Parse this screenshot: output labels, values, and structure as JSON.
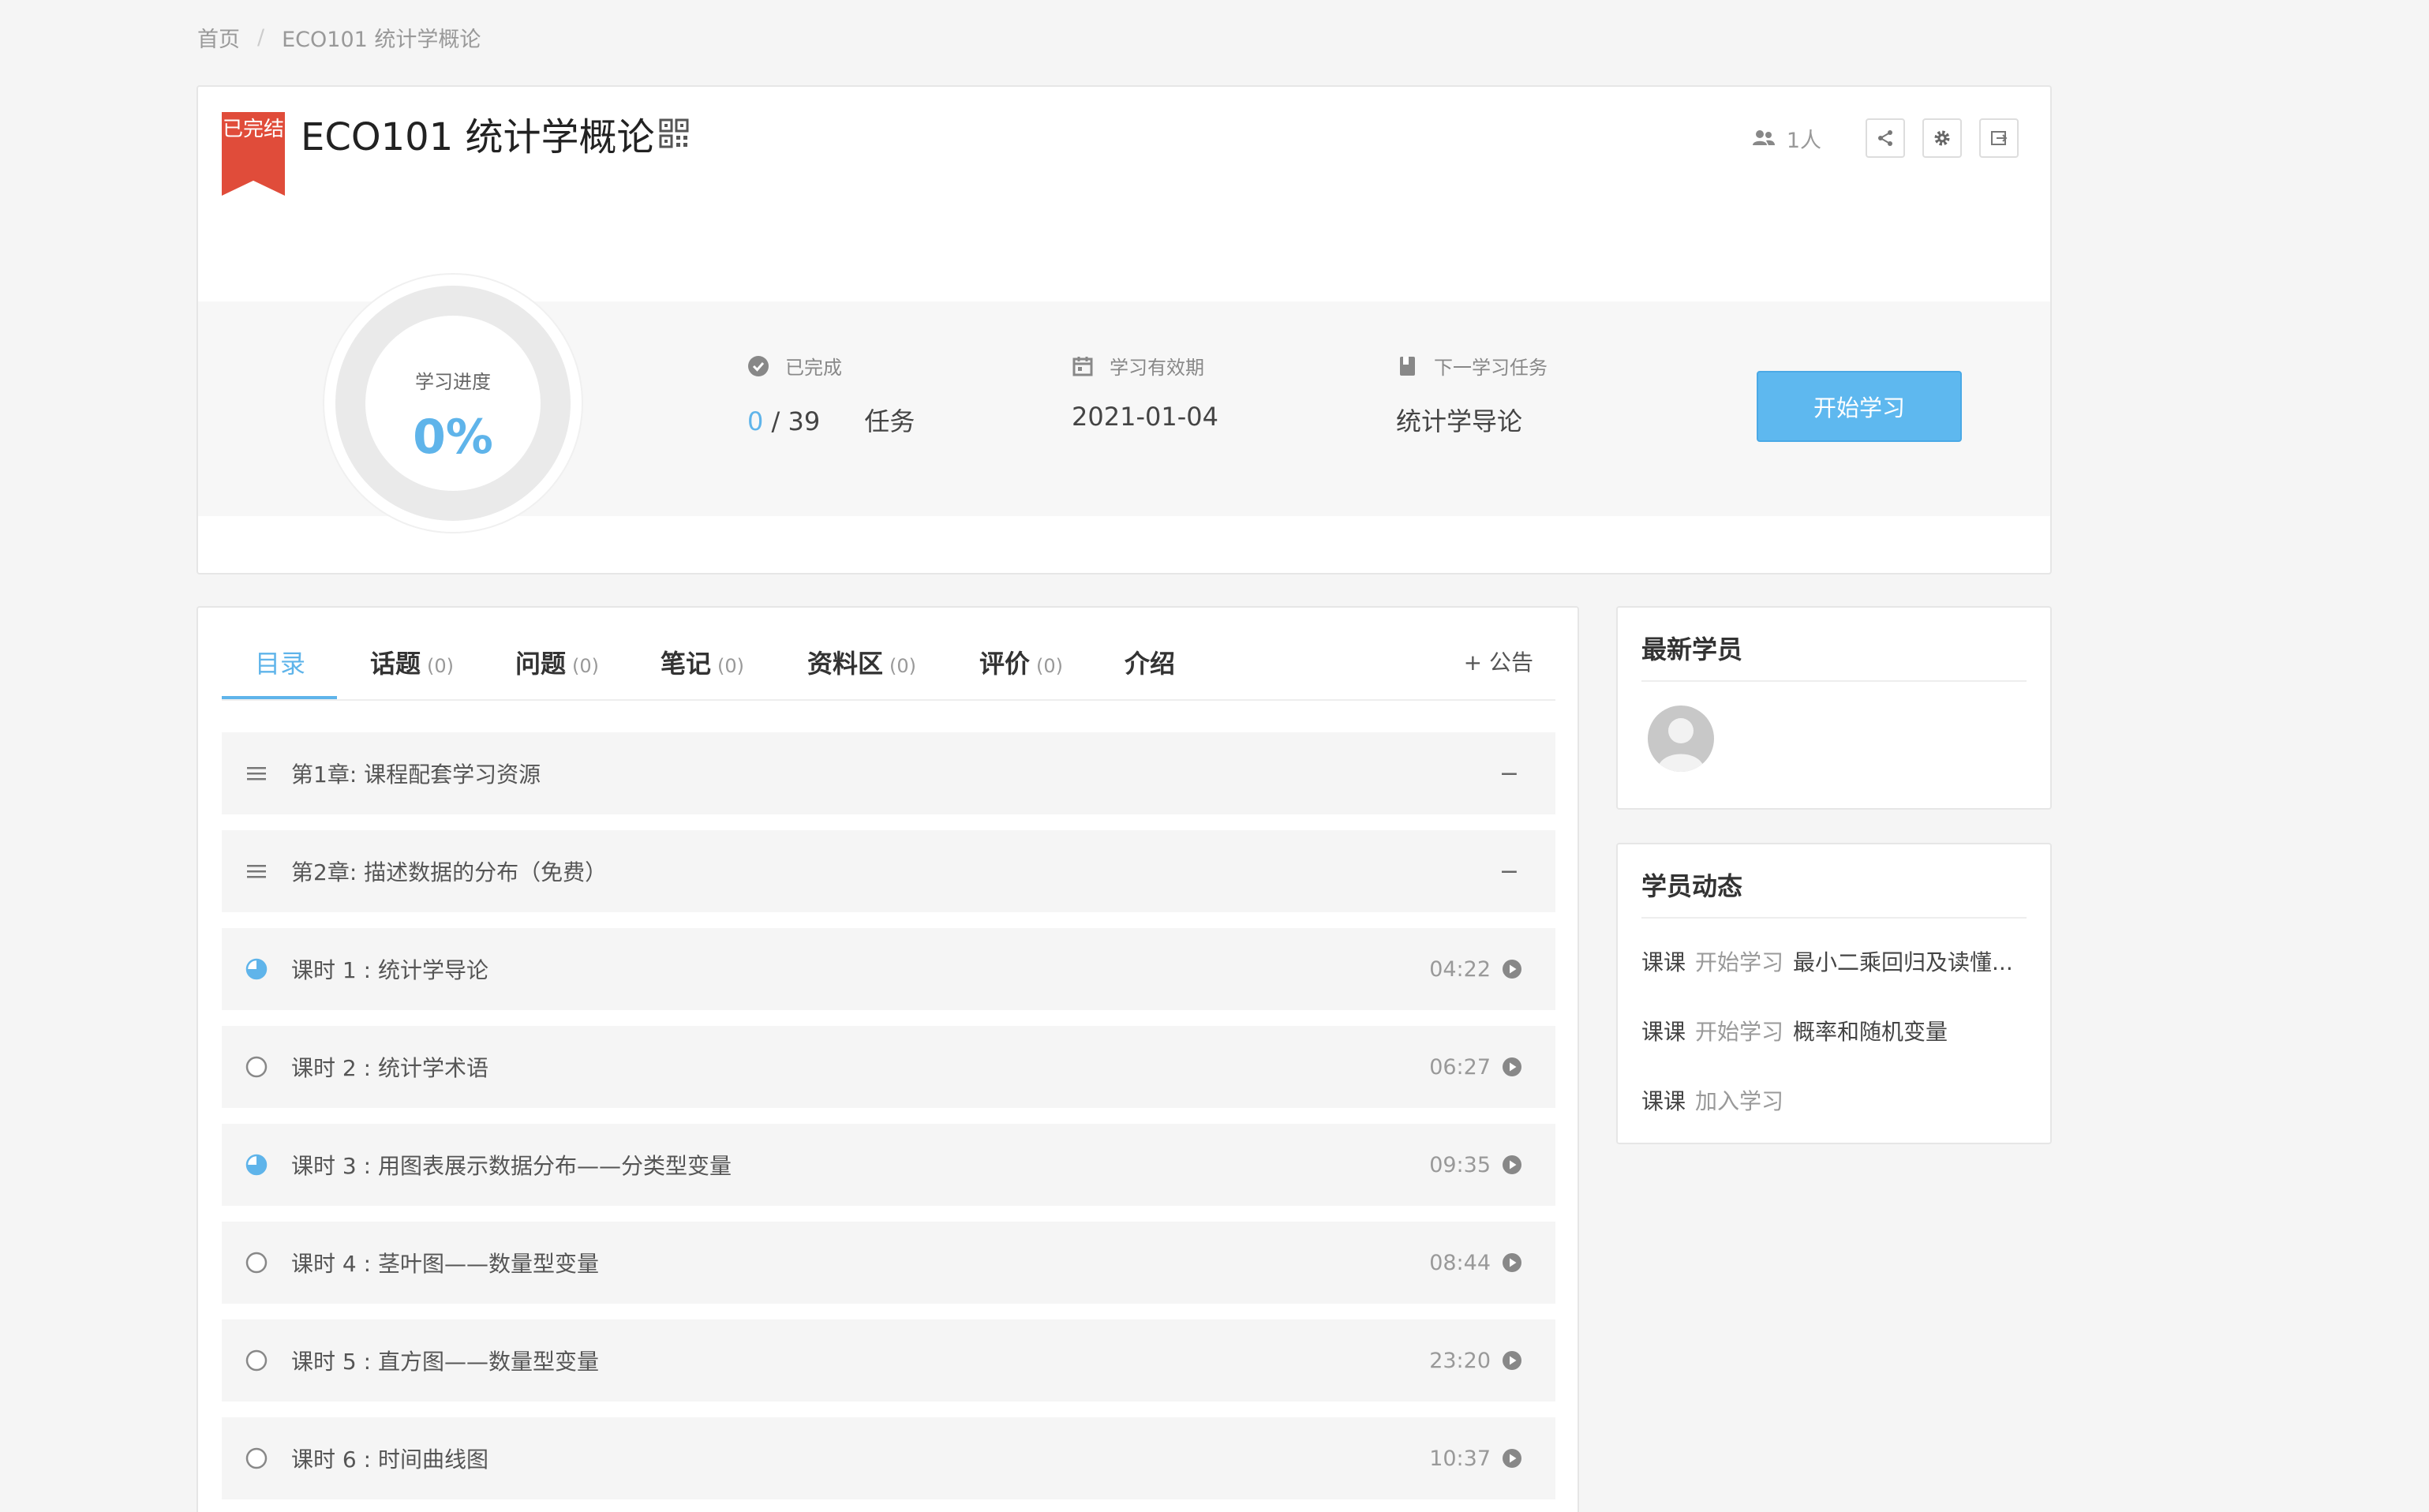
{
  "breadcrumb": {
    "home": "首页",
    "separator": "/",
    "current": "ECO101 统计学概论"
  },
  "course": {
    "badge": "已完结",
    "title": "ECO101 统计学概论",
    "member_count": "1人"
  },
  "progress": {
    "label": "学习进度",
    "value": "0%",
    "value_fraction": 0.0
  },
  "stats": {
    "completed_label": "已完成",
    "completed_done": "0",
    "completed_total": "/ 39",
    "completed_unit": "任务",
    "validity_label": "学习有效期",
    "validity_value": "2021-01-04",
    "next_label": "下一学习任务",
    "next_value": "统计学导论"
  },
  "start_button": "开始学习",
  "tabs": [
    {
      "label": "目录",
      "count": ""
    },
    {
      "label": "话题",
      "count": "(0)"
    },
    {
      "label": "问题",
      "count": "(0)"
    },
    {
      "label": "笔记",
      "count": "(0)"
    },
    {
      "label": "资料区",
      "count": "(0)"
    },
    {
      "label": "评价",
      "count": "(0)"
    },
    {
      "label": "介绍",
      "count": ""
    }
  ],
  "announce": "+ 公告",
  "chapters": [
    {
      "title": "第1章: 课程配套学习资源",
      "toggle": "−"
    },
    {
      "title": "第2章: 描述数据的分布（免费）",
      "toggle": "−"
    }
  ],
  "lessons": [
    {
      "title": "课时 1 : 统计学导论",
      "duration": "04:22",
      "status": "in-progress"
    },
    {
      "title": "课时 2 : 统计学术语",
      "duration": "06:27",
      "status": "not-started"
    },
    {
      "title": "课时 3 : 用图表展示数据分布——分类型变量",
      "duration": "09:35",
      "status": "in-progress"
    },
    {
      "title": "课时 4 : 茎叶图——数量型变量",
      "duration": "08:44",
      "status": "not-started"
    },
    {
      "title": "课时 5 : 直方图——数量型变量",
      "duration": "23:20",
      "status": "not-started"
    },
    {
      "title": "课时 6 : 时间曲线图",
      "duration": "10:37",
      "status": "not-started"
    }
  ],
  "latest_members": {
    "title": "最新学员"
  },
  "activity": {
    "title": "学员动态",
    "items": [
      {
        "user": "课课",
        "action": "开始学习",
        "target": "最小二乘回归及读懂..."
      },
      {
        "user": "课课",
        "action": "开始学习",
        "target": "概率和随机变量"
      },
      {
        "user": "课课",
        "action": "加入学习",
        "target": ""
      }
    ]
  },
  "colors": {
    "accent": "#5fb4ea",
    "ribbon": "#e04c3a",
    "button": "#5eb8ef"
  }
}
